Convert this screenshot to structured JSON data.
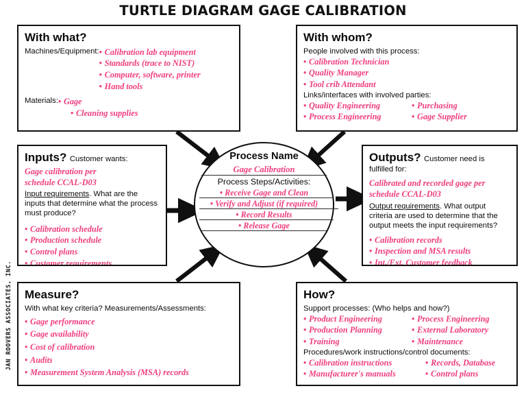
{
  "title": "TURTLE DIAGRAM GAGE CALIBRATION",
  "vertical_credit": "JAN ROOVERS ASSOCIATES, INC.",
  "colors": {
    "accent_pink": "#EE3D7F",
    "ink": "#0a0a0a",
    "border": "#101010"
  },
  "with_what": {
    "heading": "With what?",
    "label_machines": "Machines/Equipment:",
    "machines": [
      "Calibration lab equipment",
      "Standards (trace to NIST)",
      "Computer, software, printer",
      "Hand tools"
    ],
    "label_materials": "Materials:",
    "materials": [
      "Gage",
      "Cleaning supplies"
    ]
  },
  "with_whom": {
    "heading": "With whom?",
    "label_people": "People involved with this process:",
    "people": [
      "Calibration Technician",
      "Quality Manager",
      "Tool crib Attendant"
    ],
    "label_links": "Links/interfaces with involved parties:",
    "links_col1": [
      "Quality Engineering",
      "Process Engineering"
    ],
    "links_col2": [
      "Purchasing",
      "Gage Supplier"
    ]
  },
  "inputs": {
    "heading": "Inputs?",
    "subheading": "Customer wants:",
    "customer_wants": [
      "Gage calibration per",
      "schedule CCAL-D03"
    ],
    "requirement_lead": "Input requirements",
    "requirement_rest": ".  What are the inputs that determine what the process must produce?",
    "items": [
      "Calibration schedule",
      "Production schedule",
      "Control plans",
      "Customer requirements"
    ]
  },
  "outputs": {
    "heading": "Outputs?",
    "subheading": "Customer need is",
    "subheading2": "fulfilled for:",
    "fulfilled": [
      "Calibrated and recorded gage per",
      "schedule CCAL-D03"
    ],
    "requirement_lead": "Output requirements",
    "requirement_rest": ".  What output criteria are used to determine that the output meets the input requirements?",
    "items": [
      "Calibration records",
      "Inspection and MSA results",
      "Int./Ext. Customer feedback"
    ]
  },
  "process": {
    "title": "Process Name",
    "name": "Gage Calibration",
    "steps_label": "Process Steps/Activities:",
    "steps": [
      "Receive Gage and Clean",
      "Verify and Adjust (if required)",
      "Record Results",
      "Release Gage"
    ]
  },
  "measure": {
    "heading": "Measure?",
    "subheading": "With what key criteria? Measurements/Assessments:",
    "items": [
      "Gage performance",
      "Gage availability",
      "Cost of calibration",
      "Audits",
      "Measurement System Analysis  (MSA) records"
    ]
  },
  "how": {
    "heading": "How?",
    "label_support": "Support processes:  (Who helps and how?)",
    "support_col1": [
      "Product Engineering",
      "Production Planning",
      "Training"
    ],
    "support_col2": [
      "Process Engineering",
      "External Laboratory",
      "Maintenance"
    ],
    "label_procedures": "Procedures/work instructions/control documents:",
    "procedures_col1": [
      "Calibration instructions",
      "Manufacturer's manuals"
    ],
    "procedures_col2": [
      "Records, Database",
      "Control plans"
    ]
  }
}
